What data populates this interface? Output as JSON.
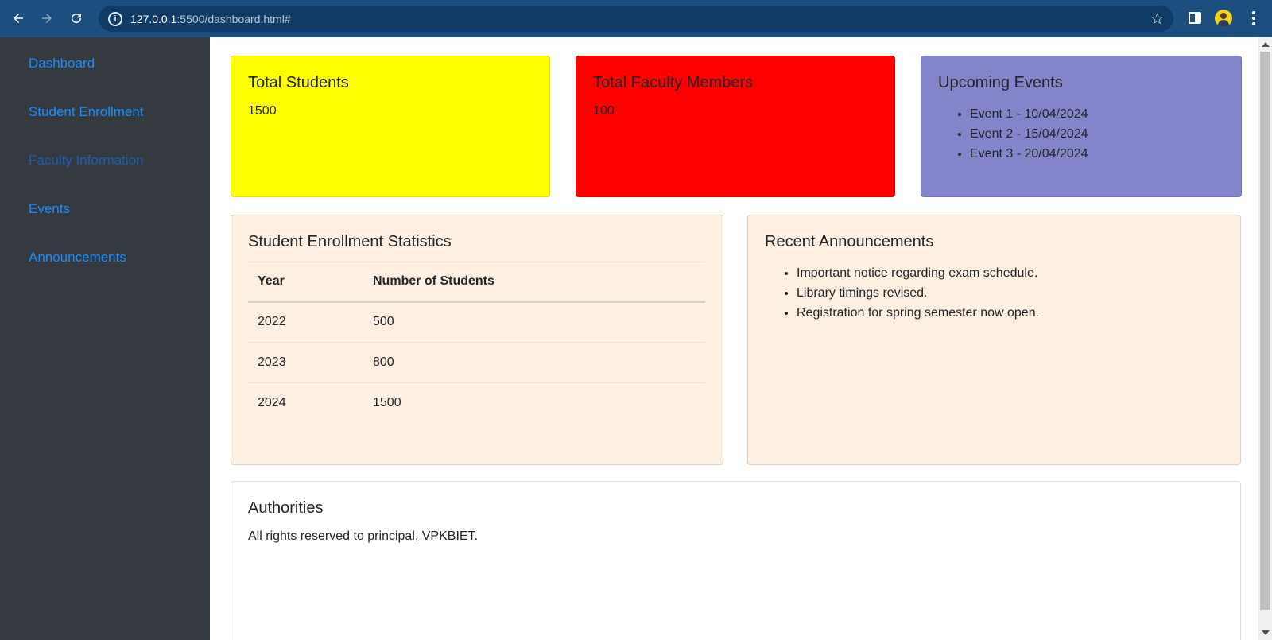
{
  "browser": {
    "url_host": "127.0.0.1",
    "url_path": ":5500/dashboard.html#",
    "back_icon": "back-arrow-icon",
    "forward_icon": "forward-arrow-icon",
    "reload_icon": "reload-icon",
    "bookmark_icon": "star-icon"
  },
  "sidebar": {
    "items": [
      {
        "label": "Dashboard"
      },
      {
        "label": "Student Enrollment"
      },
      {
        "label": "Faculty Information"
      },
      {
        "label": "Events"
      },
      {
        "label": "Announcements"
      }
    ]
  },
  "cards": {
    "total_students": {
      "title": "Total Students",
      "value": "1500",
      "color": "#ffff00"
    },
    "total_faculty": {
      "title": "Total Faculty Members",
      "value": "100",
      "color": "#ff0000"
    },
    "upcoming_events": {
      "title": "Upcoming Events",
      "color": "#8484cb",
      "items": [
        "Event 1 - 10/04/2024",
        "Event 2 - 15/04/2024",
        "Event 3 - 20/04/2024"
      ]
    },
    "enrollment_stats": {
      "title": "Student Enrollment Statistics",
      "color": "#fdefe1",
      "headers": [
        "Year",
        "Number of Students"
      ],
      "rows": [
        [
          "2022",
          "500"
        ],
        [
          "2023",
          "800"
        ],
        [
          "2024",
          "1500"
        ]
      ]
    },
    "announcements": {
      "title": "Recent Announcements",
      "color": "#fdefe1",
      "items": [
        "Important notice regarding exam schedule.",
        "Library timings revised.",
        "Registration for spring semester now open."
      ]
    },
    "authorities": {
      "title": "Authorities",
      "text": "All rights reserved to principal, VPKBIET."
    }
  }
}
